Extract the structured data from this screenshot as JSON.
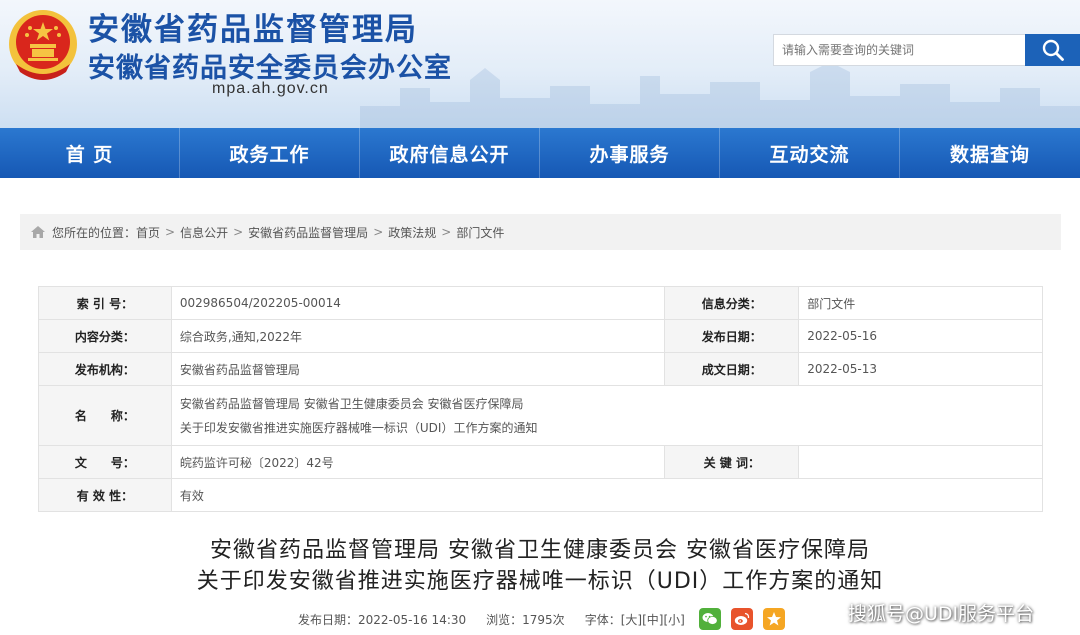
{
  "header": {
    "title": "安徽省药品监督管理局",
    "subtitle": "安徽省药品安全委员会办公室",
    "url": "mpa.ah.gov.cn",
    "search_placeholder": "请输入需要查询的关键词",
    "emblem_icon": "national-emblem"
  },
  "nav": {
    "items": [
      "首 页",
      "政务工作",
      "政府信息公开",
      "办事服务",
      "互动交流",
      "数据查询"
    ]
  },
  "breadcrumb": {
    "prefix": "您所在的位置：",
    "items": [
      "首页",
      "信息公开",
      "安徽省药品监督管理局",
      "政策法规",
      "部门文件"
    ],
    "separator": ">"
  },
  "info": {
    "index_label": "索 引 号：",
    "index_value": "002986504/202205-00014",
    "category_label": "信息分类：",
    "category_value": "部门文件",
    "content_label": "内容分类：",
    "content_value": "综合政务,通知,2022年",
    "pubdate_label": "发布日期：",
    "pubdate_value": "2022-05-16",
    "org_label": "发布机构：",
    "org_value": "安徽省药品监督管理局",
    "createdate_label": "成文日期：",
    "createdate_value": "2022-05-13",
    "name_label": "名　　称：",
    "name_line1": "安徽省药品监督管理局  安徽省卫生健康委员会  安徽省医疗保障局",
    "name_line2": "关于印发安徽省推进实施医疗器械唯一标识（UDI）工作方案的通知",
    "docno_label": "文　　号：",
    "docno_value": "皖药监许可秘〔2022〕42号",
    "keyword_label": "关 键 词：",
    "keyword_value": "",
    "validity_label": "有 效 性：",
    "validity_value": "有效"
  },
  "article": {
    "title_line1": "安徽省药品监督管理局  安徽省卫生健康委员会  安徽省医疗保障局",
    "title_line2": "关于印发安徽省推进实施医疗器械唯一标识（UDI）工作方案的通知",
    "published": "发布日期：2022-05-16 14:30",
    "views": "浏览：1795次",
    "font_label": "字体：",
    "font_large": "[大]",
    "font_medium": "[中]",
    "font_small": "[小]",
    "share_icons": [
      "wechat-icon",
      "weibo-icon",
      "qzone-icon"
    ]
  },
  "watermark": "搜狐号@UDI服务平台",
  "colors": {
    "brand_blue": "#1b52a6",
    "nav_blue": "#1658b4",
    "search_blue": "#1c62b8",
    "emblem_red": "#d9261c",
    "emblem_gold": "#f6c343"
  }
}
